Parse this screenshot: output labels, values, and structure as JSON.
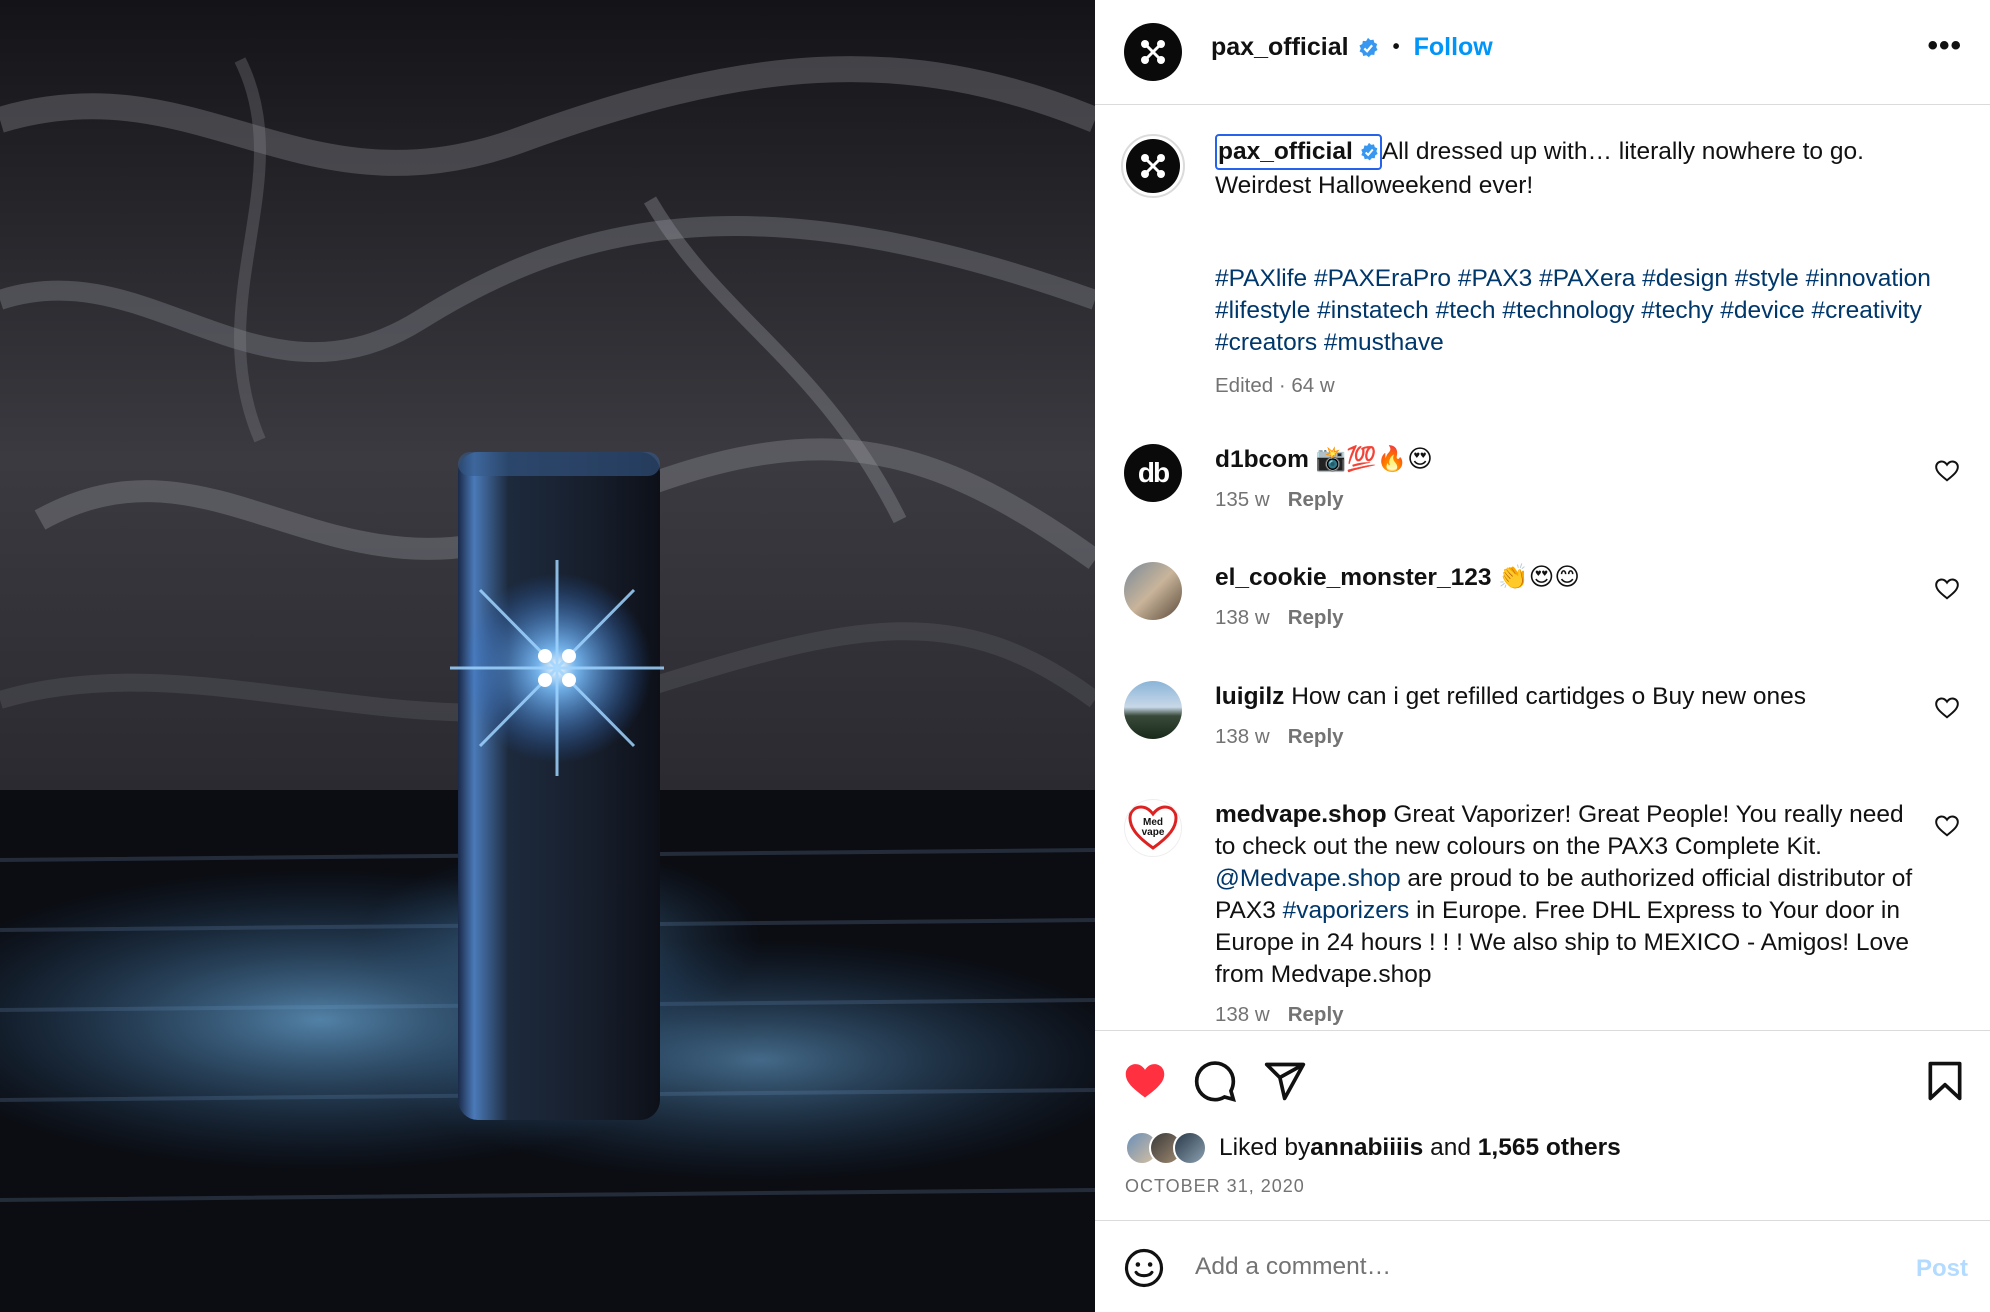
{
  "post": {
    "username": "pax_official",
    "follow_label": "Follow",
    "dot": "•",
    "more": "•••",
    "caption_text": "All dressed up with… literally nowhere to go. Weirdest Halloweekend ever!",
    "hashtags": "#PAXlife #PAXEraPro #PAX3 #PAXera #design #style #innovation #lifestyle #instatech #tech #technology #techy #device #creativity #creators #musthave",
    "edited_meta": "Edited · 64 w",
    "liked_by_prefix": "Liked by ",
    "liked_by_user": "annabiiiis",
    "liked_by_and": " and ",
    "liked_by_count": "1,565 others",
    "date": "OCTOBER 31, 2020",
    "liked": true
  },
  "comments": [
    {
      "username": "d1bcom",
      "text": "📸💯🔥😍",
      "age": "135 w",
      "reply_label": "Reply",
      "avatar_text": "db"
    },
    {
      "username": "el_cookie_monster_123",
      "text": "👏😍😊",
      "age": "138 w",
      "reply_label": "Reply"
    },
    {
      "username": "luigilz",
      "text": "How can i get refilled cartidges o Buy new ones",
      "age": "138 w",
      "reply_label": "Reply"
    },
    {
      "username": "medvape.shop",
      "text_1": "Great Vaporizer! Great People! You really need to check out the new colours on the PAX3 Complete Kit. ",
      "mention": "@Medvape.shop",
      "text_2": " are proud to be authorized official distributor of PAX3 ",
      "hashtag": "#vaporizers",
      "text_3": " in Europe. Free DHL Express to Your door in Europe in 24 hours ! ! ! We also ship to MEXICO - Amigos! Love from Medvape.shop",
      "age": "138 w",
      "reply_label": "Reply",
      "avatar_text": "Med vape"
    }
  ],
  "add_comment": {
    "placeholder": "Add a comment…",
    "post_label": "Post"
  },
  "colors": {
    "accent": "#0095f6",
    "like_red": "#ff3040",
    "hashtag": "#00376b",
    "muted": "#737373"
  },
  "icons": [
    "verified-badge-icon",
    "more-options-icon",
    "like-heart-icon",
    "comment-icon",
    "share-icon",
    "save-bookmark-icon",
    "emoji-icon"
  ]
}
